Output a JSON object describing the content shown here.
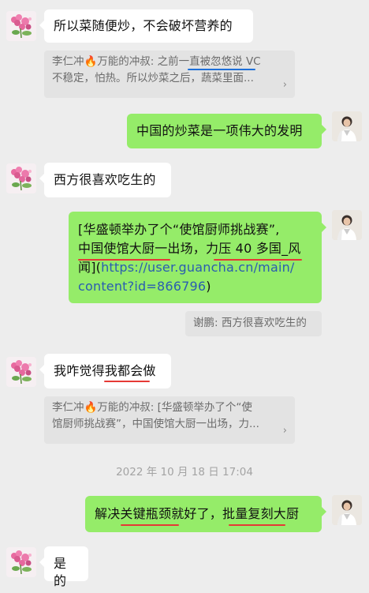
{
  "messages": {
    "m1": "所以菜随便炒，不会破坏营养的",
    "q1_line1": "李仁冲🔥万能的冲叔: 之前一直被忽悠说 VC",
    "q1_line2": "不稳定，怕热。所以炒菜之后，蔬菜里面...",
    "m2": "中国的炒菜是一项伟大的发明",
    "m3": "西方很喜欢吃生的",
    "m4_line1": "[华盛顿举办了个“使馆厨师挑战赛”,",
    "m4_line2": "中国使馆大厨一出场，力压 40 多国_风",
    "m4_line3_text": "闻](",
    "m4_link1": "https://user.guancha.cn/main/",
    "m4_link2": "content?id=866796",
    "m4_line4_end": ")",
    "q2": "谢鹏: 西方很喜欢吃生的",
    "m5": "我咋觉得我都会做",
    "q3_line1": "李仁冲🔥万能的冲叔: [华盛顿举办了个“使",
    "q3_line2": "馆厨师挑战赛”，中国使馆大厨一出场，力...",
    "timestamp": "2022 年 10 月 18 日 17:04",
    "m6": "解决关键瓶颈就好了，批量复刻大厨",
    "m7": "是的"
  },
  "icons": {
    "chevron": "›",
    "left_avatar": "flower-avatar-icon",
    "right_avatar": "person-avatar-icon"
  },
  "colors": {
    "background": "#ededed",
    "green_bubble": "#95ec69",
    "white_bubble": "#ffffff",
    "quote_bg": "#e3e3e3",
    "underline_red": "#e53935",
    "underline_blue": "#1e6fd9"
  }
}
